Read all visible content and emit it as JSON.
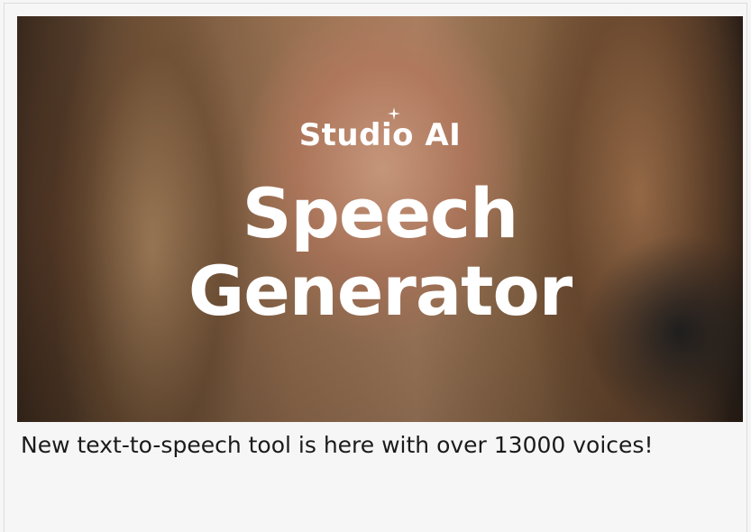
{
  "hero": {
    "brand": "Studio AI",
    "headline_line1": "Speech",
    "headline_line2": "Generator"
  },
  "caption": "New text-to-speech tool is here with over 13000 voices!",
  "colors": {
    "background": "#f6f6f6",
    "text": "#1b1b1b",
    "overlay_text": "#ffffff"
  }
}
